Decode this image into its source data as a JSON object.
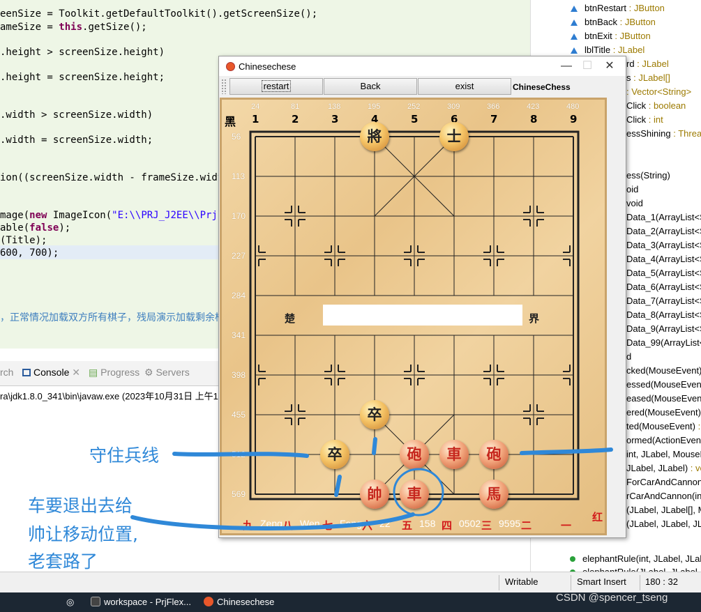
{
  "editor": {
    "lines": [
      {
        "pre": "eenSize = Toolkit.",
        "it": "getDefaultToolkit",
        "post": "().getScreenSize();"
      },
      {
        "pre": "ameSize = ",
        "kw": "this",
        "post": ".getSize();"
      },
      {
        "pre": ".height > screenSize.height)"
      },
      {
        "pre": ".height = screenSize.height;"
      },
      {
        "pre": ".width > screenSize.width)"
      },
      {
        "pre": ".width = screenSize.width;"
      },
      {
        "pre": "ion((screenSize.width - frameSize.width"
      },
      {
        "pre": "mage(",
        "kw": "new",
        "post": " ImageIcon(",
        "str": "\"E:\\\\PRJ_J2EE\\\\PrjFl"
      },
      {
        "pre": "able(",
        "kw": "false",
        "post": ");"
      },
      {
        "pre": "(Title);"
      },
      {
        "pre": "600, 700);"
      },
      {
        "pre": "，正常情况加载双方所有棋子，残局演示加载剩余棋"
      }
    ]
  },
  "console": {
    "tabs": [
      {
        "label": "rch",
        "active": false
      },
      {
        "label": "Console",
        "active": true
      },
      {
        "label": "Progress",
        "active": false
      },
      {
        "label": "Servers",
        "active": false
      }
    ],
    "line": "ra\\jdk1.8.0_341\\bin\\javaw.exe (2023年10月31日 上午12:"
  },
  "outline": {
    "fields": [
      {
        "name": "btnRestart",
        "type": " : JButton"
      },
      {
        "name": "btnBack",
        "type": " : JButton"
      },
      {
        "name": "btnExit",
        "type": " : JButton"
      },
      {
        "name": "lblTitle",
        "type": " : JLabel"
      }
    ],
    "partial": [
      {
        "text": "rd",
        "type": " : JLabel"
      },
      {
        "text": "s",
        "type": " : JLabel[]"
      },
      {
        "text": "",
        "type": " : Vector<String>"
      },
      {
        "text": "Click",
        "type": " : boolean"
      },
      {
        "text": "Click",
        "type": " : int"
      },
      {
        "text": "essShining",
        "type": " : Thread"
      },
      {
        "text": "",
        "type": ""
      },
      {
        "text": "",
        "type": ""
      },
      {
        "text": "ess(String)",
        "type": ""
      },
      {
        "text": "oid",
        "type": ""
      },
      {
        "text": "void",
        "type": ""
      },
      {
        "text": "Data_1(ArrayList<S",
        "type": ""
      },
      {
        "text": "Data_2(ArrayList<S",
        "type": ""
      },
      {
        "text": "Data_3(ArrayList<S",
        "type": ""
      },
      {
        "text": "Data_4(ArrayList<S",
        "type": ""
      },
      {
        "text": "Data_5(ArrayList<S",
        "type": ""
      },
      {
        "text": "Data_6(ArrayList<S",
        "type": ""
      },
      {
        "text": "Data_7(ArrayList<S",
        "type": ""
      },
      {
        "text": "Data_8(ArrayList<S",
        "type": ""
      },
      {
        "text": "Data_9(ArrayList<S",
        "type": ""
      },
      {
        "text": "Data_99(ArrayList<",
        "type": ""
      },
      {
        "text": "d",
        "type": ""
      },
      {
        "text": "cked(MouseEvent)",
        "type": ""
      },
      {
        "text": "essed(MouseEvent)",
        "type": ""
      },
      {
        "text": "eased(MouseEvent",
        "type": ""
      },
      {
        "text": "ered(MouseEvent)",
        "type": ""
      },
      {
        "text": "ted(MouseEvent)",
        "type": " : "
      },
      {
        "text": "ormed(ActionEvent",
        "type": ""
      },
      {
        "text": "int, JLabel, MouseE",
        "type": ""
      },
      {
        "text": "JLabel, JLabel)",
        "type": " : vo"
      },
      {
        "text": "ForCarAndCannon(",
        "type": ""
      },
      {
        "text": "rCarAndCannon(int",
        "type": ""
      },
      {
        "text": "(JLabel, JLabel[], M",
        "type": ""
      },
      {
        "text": "(JLabel, JLabel, JLa",
        "type": ""
      }
    ],
    "methods": [
      {
        "name": "elephantRule(int, JLabel, JLab"
      },
      {
        "name": "elephantRule(JLabel, JLabel, JL"
      }
    ]
  },
  "statusbar": {
    "writable": "Writable",
    "insert": "Smart Insert",
    "position": "180 : 32"
  },
  "taskbar": {
    "item1": "workspace - PrjFlex...",
    "item2": "Chinesechese"
  },
  "watermark": "CSDN @spencer_tseng",
  "game": {
    "title": "Chinesechese",
    "buttons": {
      "restart": "restart",
      "back": "Back",
      "exit": "exist"
    },
    "label": "ChineseChess",
    "board": {
      "top_coords": [
        "24",
        "81",
        "138",
        "195",
        "252",
        "309",
        "366",
        "423",
        "480"
      ],
      "col_nums": [
        "1",
        "2",
        "3",
        "4",
        "5",
        "6",
        "7",
        "8",
        "9"
      ],
      "black_label": "黑",
      "row_coords": [
        "56",
        "113",
        "170",
        "227",
        "284",
        "341",
        "398",
        "455",
        "512",
        "569"
      ],
      "river_left": "楚",
      "river_right": "界",
      "bottom_red": [
        "九",
        "八",
        "七",
        "六",
        "五",
        "四",
        "三",
        "二",
        "一"
      ],
      "red_label": "红",
      "bottom_text": [
        "Zeng",
        "Wen",
        "Feng",
        "22",
        "158",
        "0502",
        "9595"
      ]
    },
    "pieces": [
      {
        "char": "將",
        "side": "black"
      },
      {
        "char": "士",
        "side": "black"
      },
      {
        "char": "卒",
        "side": "black"
      },
      {
        "char": "卒",
        "side": "black"
      },
      {
        "char": "砲",
        "side": "red"
      },
      {
        "char": "車",
        "side": "red"
      },
      {
        "char": "砲",
        "side": "red"
      },
      {
        "char": "帥",
        "side": "red"
      },
      {
        "char": "車",
        "side": "red"
      },
      {
        "char": "馬",
        "side": "red"
      }
    ]
  },
  "annotations": {
    "guard": "守住兵线",
    "note1": "车要退出去给",
    "note2": "帅让移动位置,",
    "note3": "老套路了"
  }
}
